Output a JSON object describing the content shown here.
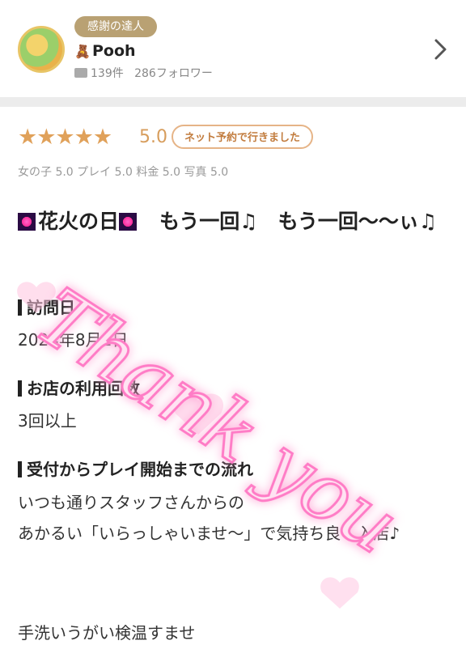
{
  "profile": {
    "rank_badge": "感謝の達人",
    "name": "Pooh",
    "review_count": "139件",
    "followers": "286フォロワー"
  },
  "review": {
    "stars": "★★★★★",
    "score": "5.0",
    "reserve_label": "ネット予約で行きました",
    "subscores": "女の子 5.0 プレイ 5.0 料金 5.0 写真 5.0",
    "title": "花火の日",
    "title_rest": "　もう一回♫　もう一回〜〜ぃ♫",
    "sections": [
      {
        "heading": "訪問日",
        "value": "2024年8月1日"
      },
      {
        "heading": "お店の利用回数",
        "value": "3回以上"
      },
      {
        "heading": "受付からプレイ開始までの流れ"
      }
    ],
    "body": "いつも通りスタッフさんからの\nあかるい「いらっしゃいませ〜」で気持ち良く入店♪",
    "body_more": "手洗いうがい検温すませ"
  },
  "overlay": {
    "text": "Thank you"
  },
  "colors": {
    "accent": "#e0a15a",
    "badge": "#b9a173",
    "overlay": "#ff8fd0"
  }
}
